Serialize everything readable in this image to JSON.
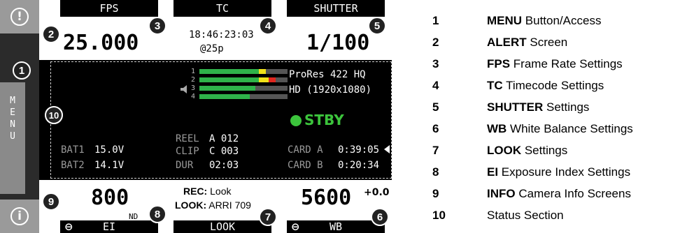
{
  "camera": {
    "sidebar": {
      "menu_letters": [
        "M",
        "E",
        "N",
        "U"
      ],
      "alert_glyph": "!",
      "info_glyph": "i"
    },
    "fps": {
      "label": "FPS",
      "value": "25.000"
    },
    "tc": {
      "label": "TC",
      "time": "18:46:23:03",
      "rate": "@25p"
    },
    "shutter": {
      "label": "SHUTTER",
      "value": "1/100"
    },
    "status": {
      "codec": "ProRes 422 HQ",
      "resolution": "HD (1920x1080)",
      "state": "STBY",
      "audio_channels": [
        "1",
        "2",
        "3",
        "4"
      ],
      "bat1_label": "BAT1",
      "bat1_value": "15.0V",
      "bat2_label": "BAT2",
      "bat2_value": "14.1V",
      "reel_label": "REEL",
      "reel_value": "A 012",
      "clip_label": "CLIP",
      "clip_value": "C 003",
      "dur_label": "DUR",
      "dur_value": "02:03",
      "carda_label": "CARD A",
      "carda_value": "0:39:05",
      "cardb_label": "CARD B",
      "cardb_value": "0:20:34"
    },
    "ei": {
      "label": "EI",
      "value": "800",
      "nd": "ND"
    },
    "look": {
      "label": "LOOK",
      "rec_label": "REC:",
      "rec_value": "Look",
      "look_label": "LOOK:",
      "look_value": "ARRI 709"
    },
    "wb": {
      "label": "WB",
      "value": "5600",
      "tint": "+0.0"
    },
    "callouts": [
      "1",
      "2",
      "3",
      "4",
      "5",
      "6",
      "7",
      "8",
      "9",
      "10"
    ]
  },
  "legend": [
    {
      "num": "1",
      "bold": "MENU",
      "text": " Button/Access"
    },
    {
      "num": "2",
      "bold": "ALERT",
      "text": " Screen"
    },
    {
      "num": "3",
      "bold": "FPS",
      "text": " Frame Rate Settings"
    },
    {
      "num": "4",
      "bold": "TC",
      "text": " Timecode Settings"
    },
    {
      "num": "5",
      "bold": "SHUTTER",
      "text": " Settings"
    },
    {
      "num": "6",
      "bold": "WB",
      "text": " White Balance Settings"
    },
    {
      "num": "7",
      "bold": "LOOK",
      "text": " Settings"
    },
    {
      "num": "8",
      "bold": "EI",
      "text": " Exposure Index Settings"
    },
    {
      "num": "9",
      "bold": "INFO",
      "text": " Camera Info Screens"
    },
    {
      "num": "10",
      "bold": "",
      "text": "Status Section"
    }
  ],
  "colors": {
    "stby_green": "#3cc43c",
    "meter_green": "#2fb34a",
    "meter_yellow": "#f2e21a",
    "meter_red": "#e0271f"
  }
}
